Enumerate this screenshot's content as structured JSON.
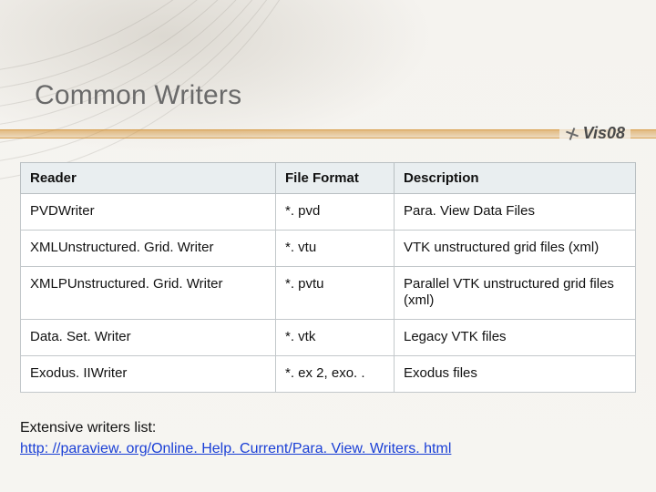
{
  "slide": {
    "title": "Common Writers",
    "logo_text": "Vis08"
  },
  "table": {
    "headers": {
      "reader": "Reader",
      "format": "File Format",
      "desc": "Description"
    },
    "rows": [
      {
        "reader": "PVDWriter",
        "format": "*. pvd",
        "desc": "Para. View Data Files"
      },
      {
        "reader": "XMLUnstructured. Grid. Writer",
        "format": "*. vtu",
        "desc": "VTK unstructured grid files (xml)"
      },
      {
        "reader": "XMLPUnstructured. Grid. Writer",
        "format": "*. pvtu",
        "desc": "Parallel VTK unstructured grid files (xml)"
      },
      {
        "reader": "Data. Set. Writer",
        "format": "*. vtk",
        "desc": "Legacy VTK files"
      },
      {
        "reader": "Exodus. IIWriter",
        "format": "*. ex 2, exo. .",
        "desc": "Exodus files"
      }
    ]
  },
  "footnote": {
    "label": "Extensive writers list:",
    "link_text": "http: //paraview. org/Online. Help. Current/Para. View. Writers. html"
  }
}
